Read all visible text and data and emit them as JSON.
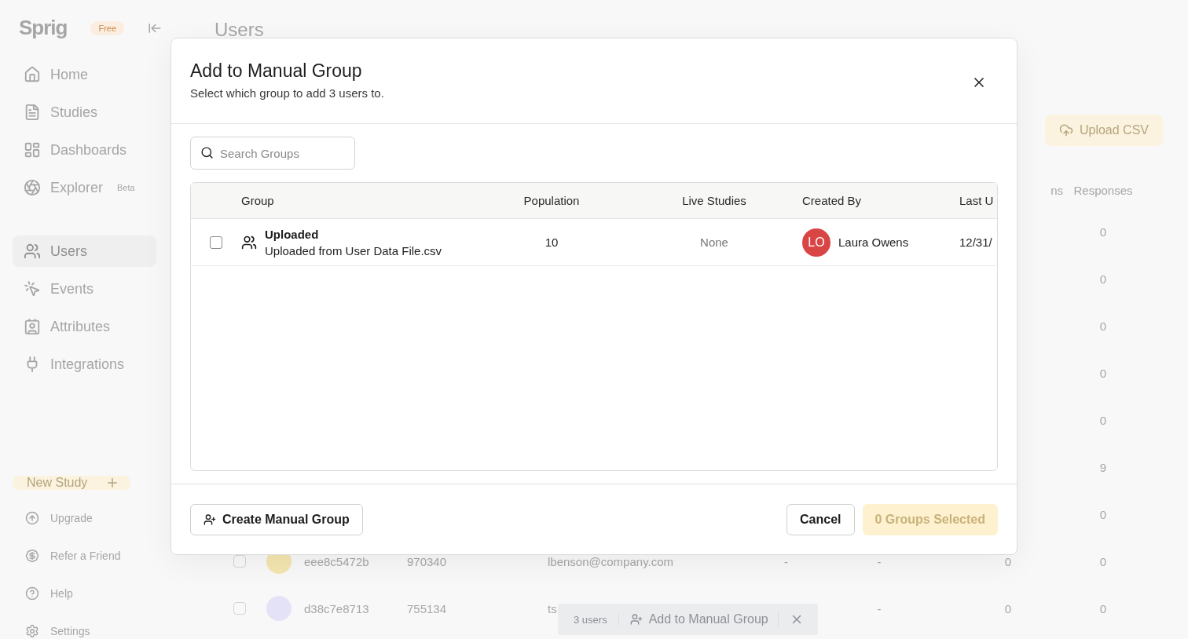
{
  "sidebar": {
    "logo": "Sprig",
    "plan_badge": "Free",
    "nav_groups": [
      [
        {
          "label": "Home",
          "selected": false
        },
        {
          "label": "Studies",
          "selected": false
        },
        {
          "label": "Dashboards",
          "selected": false
        },
        {
          "label": "Explorer",
          "selected": false,
          "badge": "Beta"
        }
      ],
      [
        {
          "label": "Users",
          "selected": true
        },
        {
          "label": "Events",
          "selected": false
        },
        {
          "label": "Attributes",
          "selected": false
        },
        {
          "label": "Integrations",
          "selected": false
        }
      ]
    ],
    "new_study_button": "New Study",
    "bottom_items": [
      {
        "label": "Upgrade"
      },
      {
        "label": "Refer a Friend"
      },
      {
        "label": "Help"
      },
      {
        "label": "Settings"
      }
    ]
  },
  "page": {
    "title": "Users",
    "upload_button": "Upload CSV",
    "table": {
      "columns": [
        "ns",
        "Responses"
      ],
      "rows": [
        {
          "responses": "0"
        },
        {
          "responses": "0"
        },
        {
          "responses": "0"
        },
        {
          "responses": "0"
        },
        {
          "responses": "0"
        },
        {
          "responses": "9"
        },
        {
          "responses": "0"
        },
        {
          "checked": false,
          "color": "#f3e6b0",
          "id": "eee8c5472b",
          "number": "970340",
          "email": "lbenson@company.com",
          "column_6": "-",
          "column_7": "-",
          "column_8": "0",
          "responses": "0"
        },
        {
          "checked": false,
          "color": "#e4e2f6",
          "id": "d38c7e8713",
          "number": "755134",
          "email": "ts",
          "column_7": "-",
          "column_8": "0",
          "responses": "0"
        }
      ]
    }
  },
  "selection_bar": {
    "count": "3 users",
    "action": "Add to Manual Group"
  },
  "dialog": {
    "title": "Add to Manual Group",
    "subtitle": "Select which group to add 3 users to.",
    "search": {
      "placeholder": "Search Groups"
    },
    "columns": [
      "Group",
      "Population",
      "Live Studies",
      "Created By",
      "Last U"
    ],
    "rows": [
      {
        "checked": false,
        "name": "Uploaded",
        "description": "Uploaded from User Data File.csv",
        "population": "10",
        "live_studies": "None",
        "creator_initials": "LO",
        "creator": "Laura Owens",
        "last_updated": "12/31/"
      }
    ],
    "create_button": "Create Manual Group",
    "cancel_button": "Cancel",
    "confirm_button": {
      "label": "0 Groups Selected",
      "disabled": true
    }
  }
}
